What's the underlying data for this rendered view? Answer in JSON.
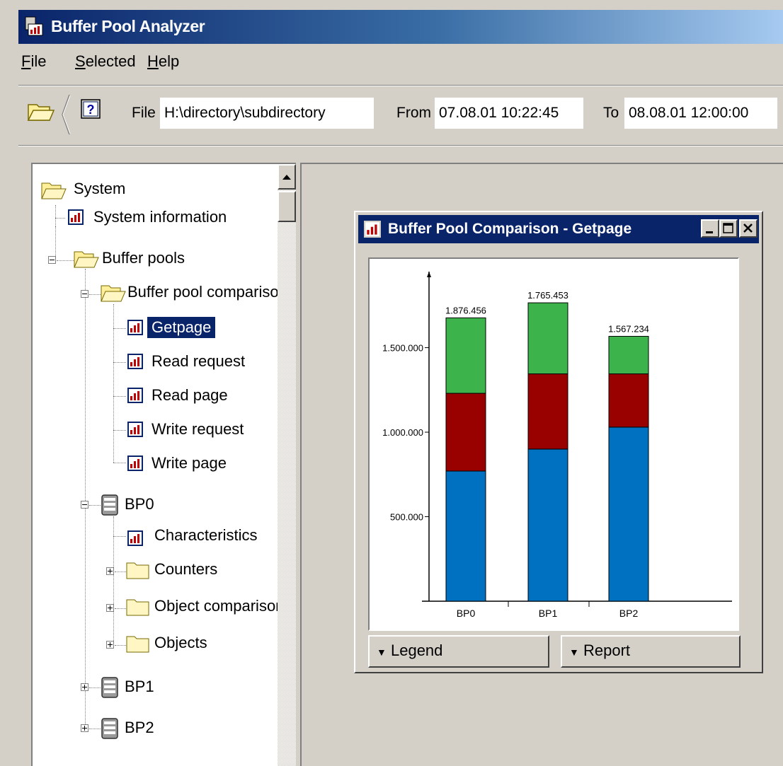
{
  "window": {
    "title": "Buffer Pool Analyzer"
  },
  "menu": [
    {
      "label": "File",
      "accel": "F",
      "rest": "ile"
    },
    {
      "label": "Selected",
      "accel": "S",
      "rest": "elected"
    },
    {
      "label": "Help",
      "accel": "H",
      "rest": "elp"
    }
  ],
  "toolbar": {
    "icons": [
      "open-folder-icon",
      "help-icon"
    ],
    "file_label": "File",
    "file_value": "H:\\directory\\subdirectory",
    "from_label": "From",
    "from_value": "07.08.01 10:22:45",
    "to_label": "To",
    "to_value": "08.08.01 12:00:00"
  },
  "tree": {
    "root": "System",
    "system_information": "System information",
    "buffer_pools": "Buffer pools",
    "comparison": "Buffer pool compariso",
    "comparison_items": [
      "Getpage",
      "Read request",
      "Read page",
      "Write request",
      "Write page"
    ],
    "bp0": "BP0",
    "bp0_items": [
      "Characteristics",
      "Counters",
      "Object comparisor",
      "Objects"
    ],
    "bp1": "BP1",
    "bp2": "BP2"
  },
  "chart_window": {
    "title": "Buffer Pool Comparison - Getpage",
    "legend_button": "Legend",
    "report_button": "Report"
  },
  "colors": {
    "green": "#3cb44b",
    "red": "#990000",
    "blue": "#0070c0",
    "title_blue": "#0a246a"
  },
  "chart_data": {
    "type": "bar",
    "stacked": true,
    "categories": [
      "BP0",
      "BP1",
      "BP2"
    ],
    "totals_labels": [
      "1.876.456",
      "1.765.453",
      "1.567.234"
    ],
    "ytick_labels": [
      "500.000",
      "1.000.000",
      "1.500.000"
    ],
    "yticks": [
      500000,
      1000000,
      1500000
    ],
    "ylim": [
      0,
      1950000
    ],
    "series": [
      {
        "color": "#0070c0",
        "values": [
          770000,
          900000,
          1030000
        ]
      },
      {
        "color": "#990000",
        "values": [
          460000,
          445000,
          315000
        ]
      },
      {
        "color": "#3cb44b",
        "values": [
          446456,
          420453,
          222234
        ]
      }
    ]
  }
}
